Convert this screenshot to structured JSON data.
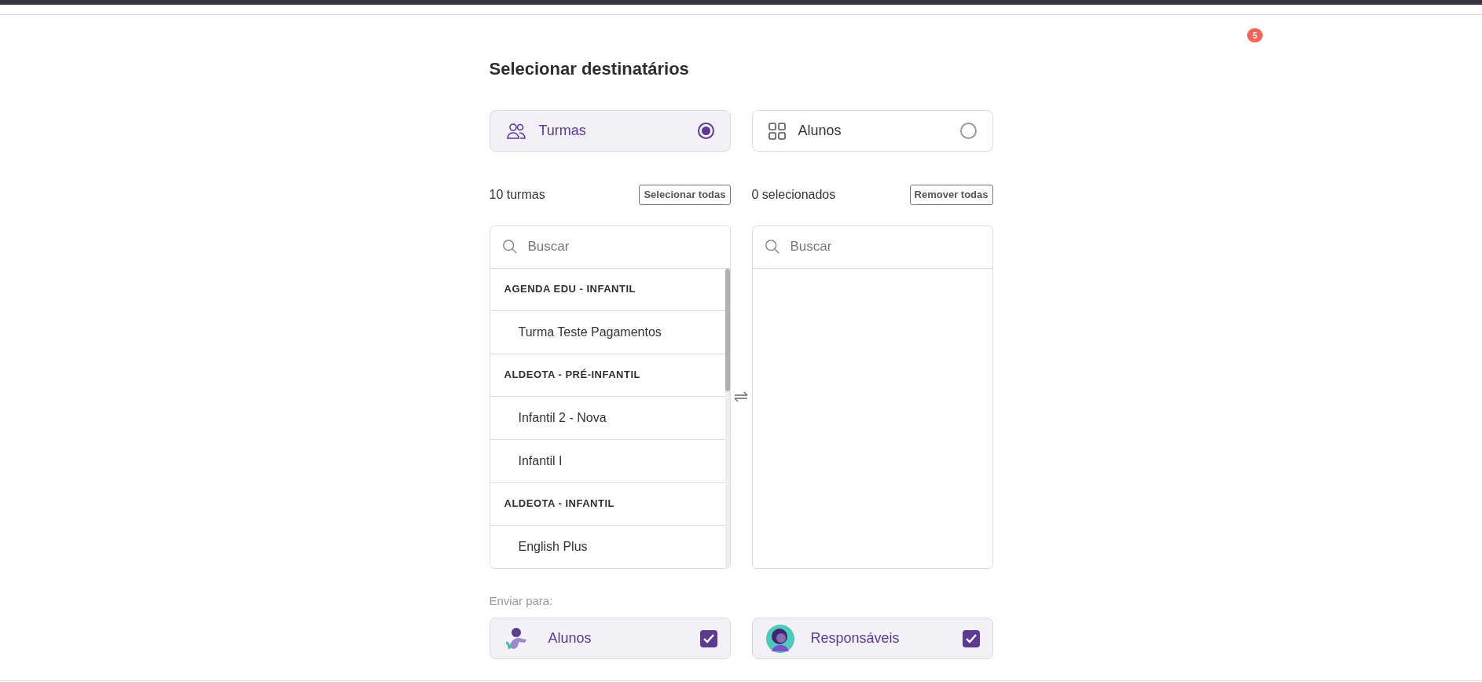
{
  "notification_badge": "5",
  "title": "Selecionar destinatários",
  "modes": [
    {
      "label": "Turmas",
      "selected": true
    },
    {
      "label": "Alunos",
      "selected": false
    }
  ],
  "available": {
    "count": "10 turmas",
    "action": "Selecionar todas",
    "search": {
      "placeholder": "Buscar"
    },
    "items": [
      {
        "kind": "group",
        "label": "AGENDA EDU - INFANTIL"
      },
      {
        "kind": "item",
        "label": "Turma Teste Pagamentos"
      },
      {
        "kind": "group",
        "label": "ALDEOTA - PRÉ-INFANTIL"
      },
      {
        "kind": "item",
        "label": "Infantil 2 - Nova"
      },
      {
        "kind": "item",
        "label": "Infantil I"
      },
      {
        "kind": "group",
        "label": "ALDEOTA - INFANTIL"
      },
      {
        "kind": "item",
        "label": "English Plus"
      }
    ]
  },
  "selected_list": {
    "count": "0 selecionados",
    "action": "Remover todas",
    "search": {
      "placeholder": "Buscar"
    }
  },
  "send_to": {
    "label": "Enviar para:",
    "options": [
      {
        "label": "Alunos",
        "checked": true
      },
      {
        "label": "Responsáveis",
        "checked": true
      }
    ]
  }
}
